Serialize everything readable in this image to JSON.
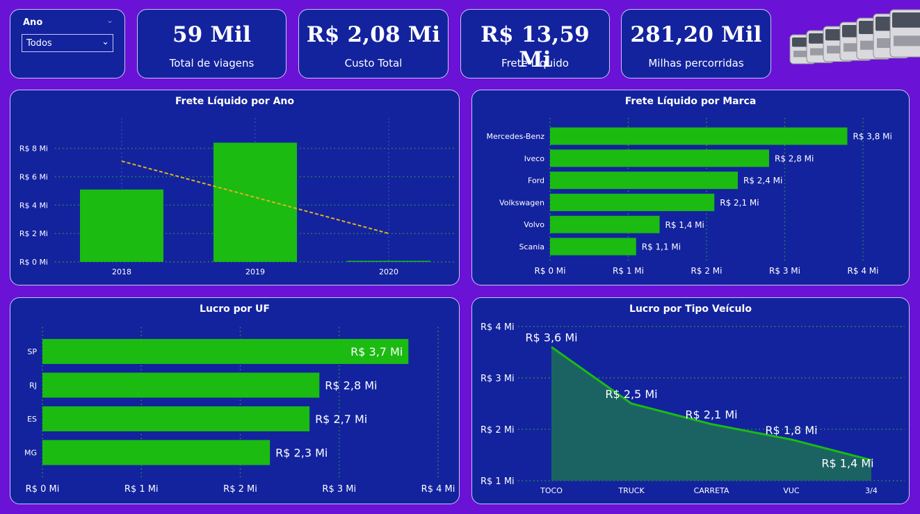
{
  "slicer": {
    "title": "Ano",
    "value": "Todos"
  },
  "kpis": [
    {
      "value": "59 Mil",
      "label": "Total de viagens"
    },
    {
      "value": "R$ 2,08 Mi",
      "label": "Custo Total"
    },
    {
      "value": "R$ 13,59 Mi",
      "label": "Frete Líquido"
    },
    {
      "value": "281,20 Mil",
      "label": "Milhas percorridas"
    }
  ],
  "colors": {
    "background": "#6a12d6",
    "panel": "#13239e",
    "bar": "#1bbb12",
    "trend": "#e0b21e",
    "area": "#1b6363",
    "grid": "#2e9a3a"
  },
  "chart_data": [
    {
      "type": "bar",
      "title": "Frete Líquido por Ano",
      "categories": [
        "2018",
        "2019",
        "2020"
      ],
      "values": [
        5.1,
        8.4,
        0.05
      ],
      "trendline": [
        7.1,
        2.0
      ],
      "y_ticks": [
        "R$ 0 Mi",
        "R$ 2 Mi",
        "R$ 4 Mi",
        "R$ 6 Mi",
        "R$ 8 Mi"
      ],
      "ylim": [
        0,
        9.4
      ],
      "grid": true
    },
    {
      "type": "bar",
      "orientation": "horizontal",
      "title": "Frete Líquido por Marca",
      "categories": [
        "Mercedes-Benz",
        "Iveco",
        "Ford",
        "Volkswagen",
        "Volvo",
        "Scania"
      ],
      "values": [
        3.8,
        2.8,
        2.4,
        2.1,
        1.4,
        1.1
      ],
      "data_labels": [
        "R$ 3,8 Mi",
        "R$ 2,8 Mi",
        "R$ 2,4 Mi",
        "R$ 2,1 Mi",
        "R$ 1,4 Mi",
        "R$ 1,1 Mi"
      ],
      "x_ticks": [
        "R$ 0 Mi",
        "R$ 1 Mi",
        "R$ 2 Mi",
        "R$ 3 Mi",
        "R$ 4 Mi"
      ],
      "xlim": [
        0,
        4
      ],
      "grid": true
    },
    {
      "type": "bar",
      "orientation": "horizontal",
      "title": "Lucro por UF",
      "categories": [
        "SP",
        "RJ",
        "ES",
        "MG"
      ],
      "values": [
        3.7,
        2.8,
        2.7,
        2.3
      ],
      "data_labels": [
        "R$ 3,7 Mi",
        "R$ 2,8 Mi",
        "R$ 2,7 Mi",
        "R$ 2,3 Mi"
      ],
      "x_ticks": [
        "R$ 0 Mi",
        "R$ 1 Mi",
        "R$ 2 Mi",
        "R$ 3 Mi",
        "R$ 4 Mi"
      ],
      "xlim": [
        0,
        4
      ],
      "grid": true
    },
    {
      "type": "area",
      "title": "Lucro por Tipo Veículo",
      "categories": [
        "TOCO",
        "TRUCK",
        "CARRETA",
        "VUC",
        "3/4"
      ],
      "values": [
        3.6,
        2.5,
        2.1,
        1.8,
        1.4
      ],
      "data_labels": [
        "R$ 3,6 Mi",
        "R$ 2,5 Mi",
        "R$ 2,1 Mi",
        "R$ 1,8 Mi",
        "R$ 1,4 Mi"
      ],
      "y_ticks": [
        "R$ 1 Mi",
        "R$ 2 Mi",
        "R$ 3 Mi",
        "R$ 4 Mi"
      ],
      "ylim": [
        1,
        4
      ],
      "grid": true
    }
  ]
}
